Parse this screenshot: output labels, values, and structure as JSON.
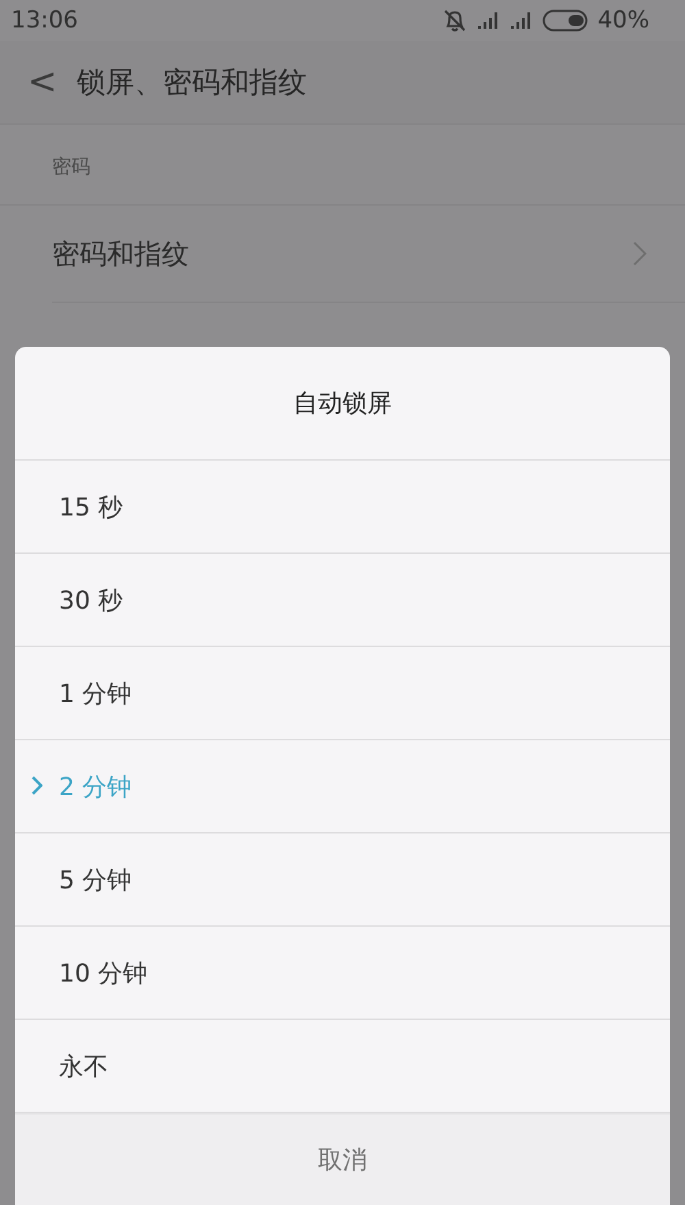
{
  "status_bar": {
    "time": "13:06",
    "battery": "40%"
  },
  "header": {
    "back": "<",
    "title": "锁屏、密码和指纹"
  },
  "section": {
    "label": "密码"
  },
  "rows": [
    {
      "label": "密码和指纹"
    }
  ],
  "dialog": {
    "title": "自动锁屏",
    "options": [
      {
        "label": "15 秒",
        "selected": false
      },
      {
        "label": "30 秒",
        "selected": false
      },
      {
        "label": "1 分钟",
        "selected": false
      },
      {
        "label": "2 分钟",
        "selected": true
      },
      {
        "label": "5 分钟",
        "selected": false
      },
      {
        "label": "10 分钟",
        "selected": false
      },
      {
        "label": "永不",
        "selected": false
      }
    ],
    "cancel": "取消"
  }
}
